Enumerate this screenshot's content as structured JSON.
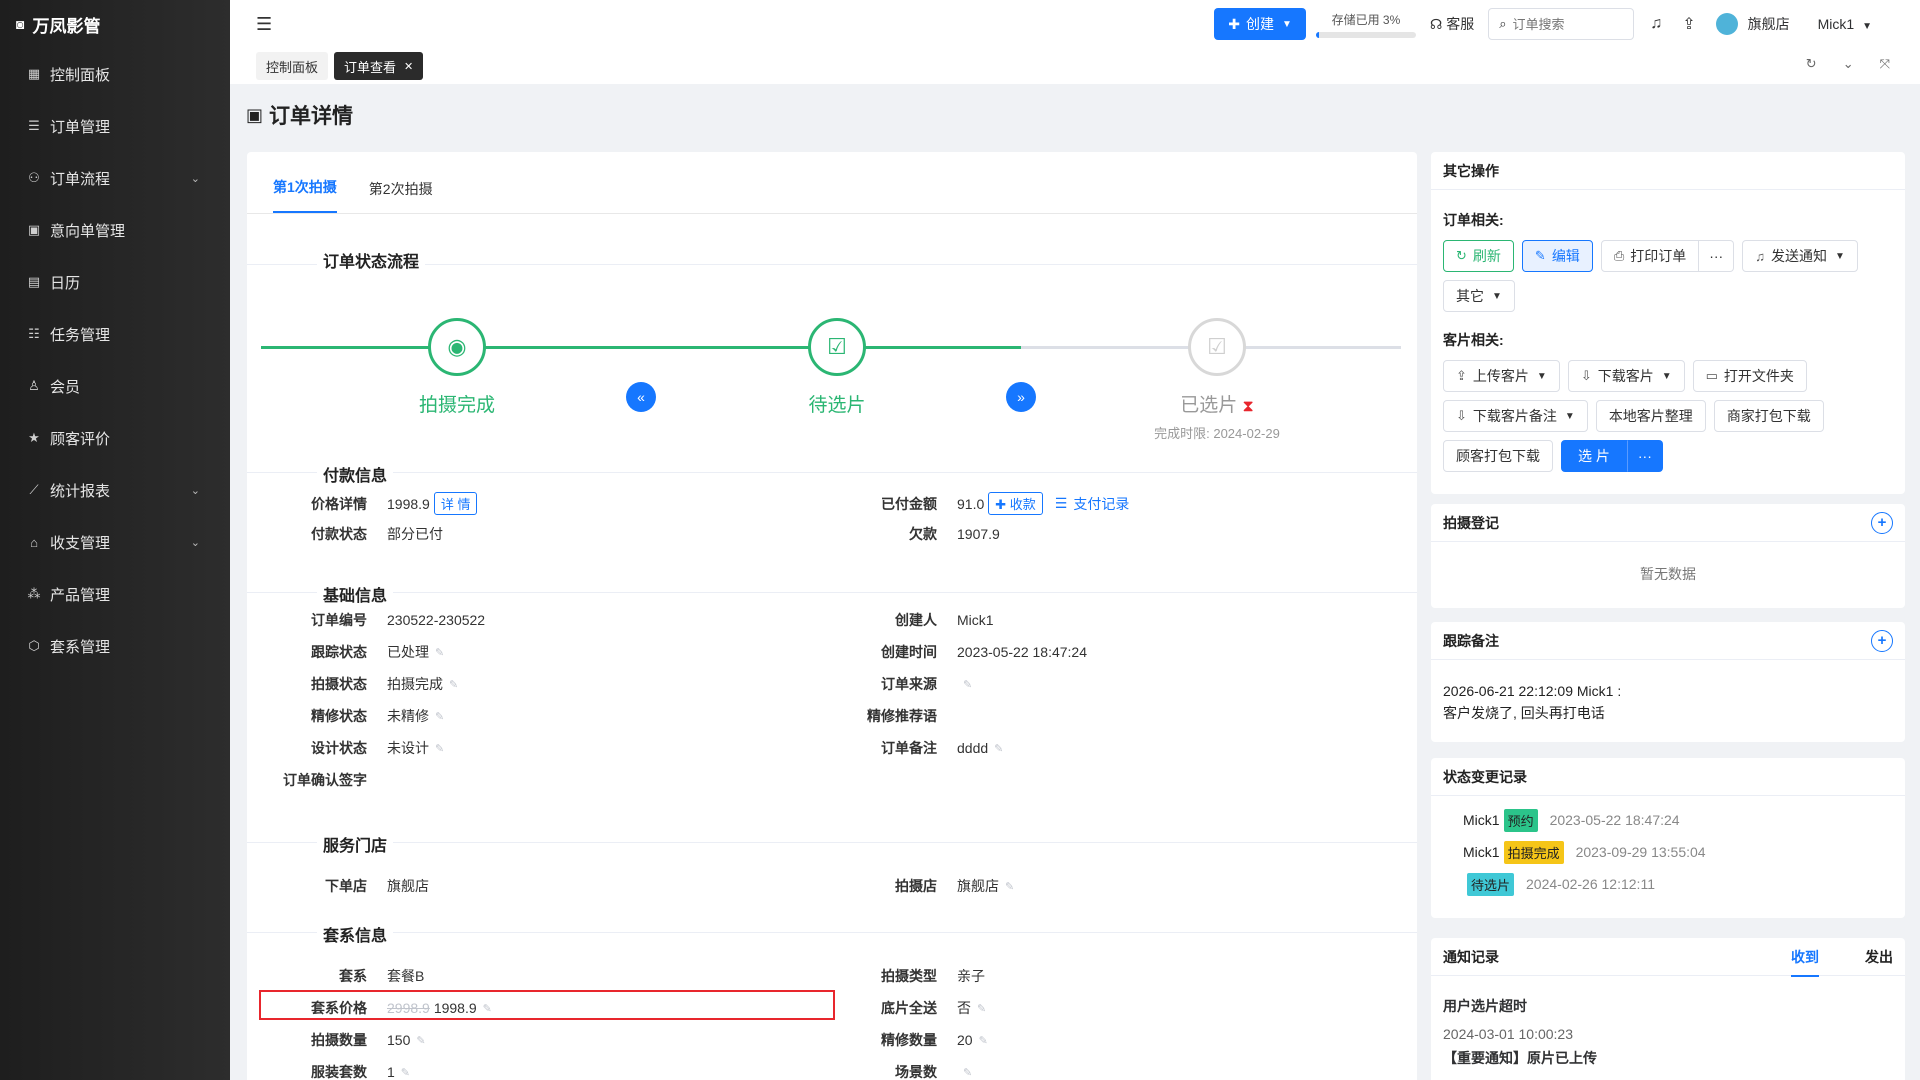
{
  "app": {
    "brand": "万凤影管"
  },
  "sidebar": {
    "items": [
      {
        "label": "控制面板",
        "icon": "dashboard-icon",
        "glyph": "▦",
        "arrow": false
      },
      {
        "label": "订单管理",
        "icon": "list-icon",
        "glyph": "☰",
        "arrow": false
      },
      {
        "label": "订单流程",
        "icon": "flow-icon",
        "glyph": "⚇",
        "arrow": true
      },
      {
        "label": "意向单管理",
        "icon": "intent-icon",
        "glyph": "▣",
        "arrow": false
      },
      {
        "label": "日历",
        "icon": "calendar-icon",
        "glyph": "▤",
        "arrow": false
      },
      {
        "label": "任务管理",
        "icon": "task-icon",
        "glyph": "☷",
        "arrow": false
      },
      {
        "label": "会员",
        "icon": "member-icon",
        "glyph": "♙",
        "arrow": false
      },
      {
        "label": "顾客评价",
        "icon": "star-icon",
        "glyph": "★",
        "arrow": false
      },
      {
        "label": "统计报表",
        "icon": "chart-icon",
        "glyph": "⟋",
        "arrow": true
      },
      {
        "label": "收支管理",
        "icon": "bank-icon",
        "glyph": "⌂",
        "arrow": true
      },
      {
        "label": "产品管理",
        "icon": "product-icon",
        "glyph": "⁂",
        "arrow": false
      },
      {
        "label": "套系管理",
        "icon": "package-icon",
        "glyph": "⬡",
        "arrow": false
      }
    ]
  },
  "header": {
    "create_label": "创建",
    "storage_label": "存储已用 3%",
    "storage_percent": 3,
    "service_label": "客服",
    "search_placeholder": "订单搜索",
    "shop_label": "旗舰店",
    "user_label": "Mick1"
  },
  "tags": {
    "dashboard": "控制面板",
    "current": "订单查看"
  },
  "page": {
    "title": "订单详情"
  },
  "tabs": [
    "第1次拍摄",
    "第2次拍摄"
  ],
  "flow": {
    "title": "订单状态流程",
    "steps": [
      {
        "label": "拍摄完成"
      },
      {
        "label": "待选片"
      },
      {
        "label": "已选片",
        "sub": "完成时限: 2024-02-29"
      }
    ]
  },
  "payment": {
    "title": "付款信息",
    "price_key": "价格详情",
    "price_val": "1998.9",
    "detail_label": "详 情",
    "status_key": "付款状态",
    "status_val": "部分已付",
    "paid_key": "已付金额",
    "paid_val": "91.0",
    "collect_label": "收款",
    "record_label": "支付记录",
    "debt_key": "欠款",
    "debt_val": "1907.9"
  },
  "basic": {
    "title": "基础信息",
    "left": [
      {
        "k": "订单编号",
        "v": "230522-230522",
        "edit": false
      },
      {
        "k": "跟踪状态",
        "v": "已处理",
        "edit": true
      },
      {
        "k": "拍摄状态",
        "v": "拍摄完成",
        "edit": true
      },
      {
        "k": "精修状态",
        "v": "未精修",
        "edit": true
      },
      {
        "k": "设计状态",
        "v": "未设计",
        "edit": true
      },
      {
        "k": "订单确认签字",
        "v": "",
        "edit": false
      }
    ],
    "right": [
      {
        "k": "创建人",
        "v": "Mick1",
        "edit": false
      },
      {
        "k": "创建时间",
        "v": "2023-05-22 18:47:24",
        "edit": false
      },
      {
        "k": "订单来源",
        "v": "",
        "edit": true
      },
      {
        "k": "精修推荐语",
        "v": "",
        "edit": false
      },
      {
        "k": "订单备注",
        "v": "dddd",
        "edit": true
      }
    ]
  },
  "store": {
    "title": "服务门店",
    "order_key": "下单店",
    "order_val": "旗舰店",
    "shoot_key": "拍摄店",
    "shoot_val": "旗舰店"
  },
  "package": {
    "title": "套系信息",
    "left": [
      {
        "k": "套系",
        "v": "套餐B",
        "edit": false
      },
      {
        "k": "套系价格",
        "old": "2998.9",
        "v": "1998.9",
        "edit": true
      },
      {
        "k": "拍摄数量",
        "v": "150",
        "edit": true
      },
      {
        "k": "服装套数",
        "v": "1",
        "edit": true
      }
    ],
    "right": [
      {
        "k": "拍摄类型",
        "v": "亲子",
        "edit": false
      },
      {
        "k": "底片全送",
        "v": "否",
        "edit": true
      },
      {
        "k": "精修数量",
        "v": "20",
        "edit": true
      },
      {
        "k": "场景数",
        "v": "",
        "edit": true
      }
    ]
  },
  "side": {
    "ops_title": "其它操作",
    "order_group": "订单相关:",
    "refresh": "刷新",
    "edit": "编辑",
    "print": "打印订单",
    "more": "···",
    "notify": "发送通知",
    "other": "其它",
    "photo_group": "客片相关:",
    "upload": "上传客片",
    "download": "下载客片",
    "open_folder": "打开文件夹",
    "download_note": "下载客片备注",
    "local_sort": "本地客片整理",
    "merchant_pack": "商家打包下载",
    "customer_pack": "顾客打包下载",
    "select": "选 片",
    "shoot_title": "拍摄登记",
    "shoot_empty": "暂无数据",
    "track_title": "跟踪备注",
    "track_line1": "2026-06-21 22:12:09 Mick1 :",
    "track_line2": "客户发烧了, 回头再打电话",
    "status_title": "状态变更记录",
    "status_logs": [
      {
        "user": "Mick1",
        "badge": "预约",
        "color": "#2bc48a",
        "time": "2023-05-22 18:47:24"
      },
      {
        "user": "Mick1",
        "badge": "拍摄完成",
        "color": "#f5c518",
        "time": "2023-09-29 13:55:04"
      },
      {
        "user": "",
        "badge": "待选片",
        "color": "#3fc8d6",
        "time": "2024-02-26 12:12:11"
      }
    ],
    "notify_title": "通知记录",
    "notify_tab_in": "收到",
    "notify_tab_out": "发出",
    "notify_item_title": "用户选片超时",
    "notify_item_time": "2024-03-01 10:00:23",
    "notify_item_msg": "【重要通知】原片已上传"
  }
}
